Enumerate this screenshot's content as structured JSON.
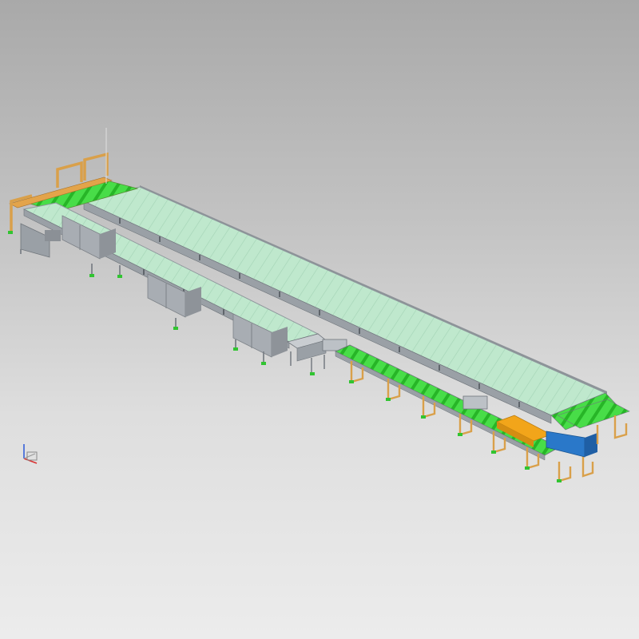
{
  "viewer": {
    "background_top": "#a9a9a9",
    "background_bottom": "#ececec",
    "colors": {
      "frame": "#9aa0a6",
      "frame_dark": "#6f757b",
      "belt": "#b9e6c8",
      "belt_line": "#9fcfb1",
      "roller": "#3fd33f",
      "roller_dark": "#22a522",
      "leg_orange": "#d9a04a",
      "leg_orange_dark": "#a8722a",
      "cabinet": "#a8adb3",
      "cabinet_dark": "#7c8187",
      "gate_yellow": "#f2a51a",
      "guard_blue": "#2a78c9",
      "foot_green": "#31c431"
    },
    "icons": [
      "axis-triad-icon"
    ]
  }
}
